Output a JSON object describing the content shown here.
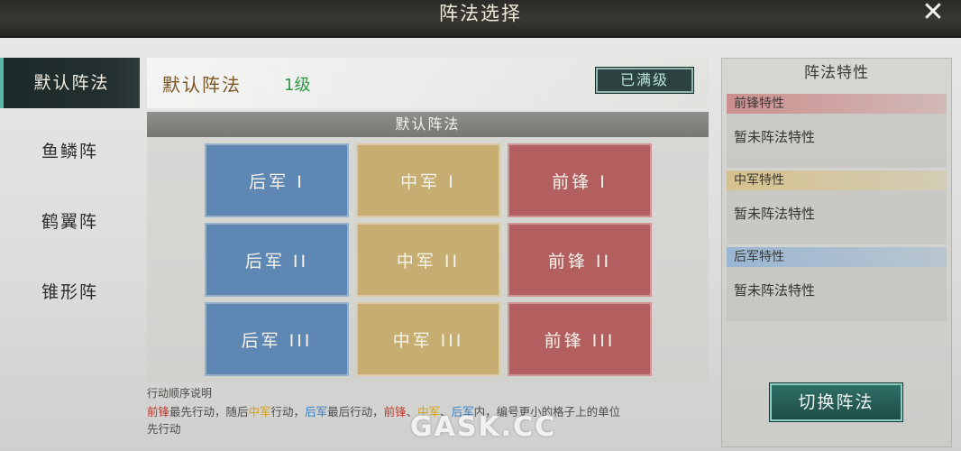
{
  "window": {
    "title": "阵法选择",
    "close_glyph": "✕"
  },
  "tabs": [
    {
      "label": "默认阵法",
      "active": true
    },
    {
      "label": "鱼鳞阵",
      "active": false
    },
    {
      "label": "鹤翼阵",
      "active": false
    },
    {
      "label": "锥形阵",
      "active": false
    }
  ],
  "formation": {
    "name": "默认阵法",
    "level": "1级",
    "maxed_label": "已满级"
  },
  "grid": {
    "title": "默认阵法",
    "rows": [
      [
        "后军 I",
        "中军 I",
        "前锋 I"
      ],
      [
        "后军 II",
        "中军 II",
        "前锋 II"
      ],
      [
        "后军 III",
        "中军 III",
        "前锋 III"
      ]
    ]
  },
  "notes": {
    "title": "行动顺序说明",
    "line1": {
      "p1": "前锋",
      "p2": "最先行动，随后",
      "p3": "中军",
      "p4": "行动，",
      "p5": "后军",
      "p6": "最后行动，",
      "p7": "前锋",
      "p8": "、",
      "p9": "中军",
      "p10": "、",
      "p11": "后军",
      "p12": "内，编号更小的格子上的单位"
    },
    "line2": "先行动"
  },
  "traits": {
    "title": "阵法特性",
    "front": {
      "label": "前锋特性",
      "value": "暂未阵法特性"
    },
    "mid": {
      "label": "中军特性",
      "value": "暂未阵法特性"
    },
    "rear": {
      "label": "后军特性",
      "value": "暂未阵法特性"
    }
  },
  "switch_label": "切换阵法",
  "watermark": "GASK.CC",
  "colors": {
    "rear": "#5f87b3",
    "mid": "#c6ae72",
    "front": "#b35f60",
    "accent": "#58b7a6"
  }
}
